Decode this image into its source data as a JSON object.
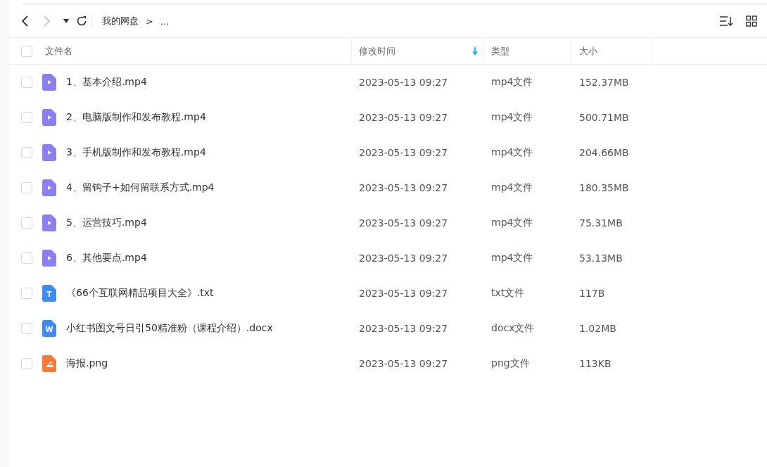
{
  "toolbar": {
    "breadcrumb": [
      {
        "label": "我的网盘"
      },
      {
        "label": "..."
      }
    ],
    "separator": ">"
  },
  "table": {
    "columns": [
      {
        "label": "文件名",
        "sorted": false
      },
      {
        "label": "修改时间",
        "sorted": true
      },
      {
        "label": "类型",
        "sorted": false
      },
      {
        "label": "大小",
        "sorted": false
      }
    ],
    "rows": [
      {
        "name": "1、基本介绍.mp4",
        "kind": "video",
        "time": "2023-05-13 09:27",
        "type": "mp4文件",
        "size": "152.37MB",
        "checked": false
      },
      {
        "name": "2、电脑版制作和发布教程.mp4",
        "kind": "video",
        "time": "2023-05-13 09:27",
        "type": "mp4文件",
        "size": "500.71MB",
        "checked": false
      },
      {
        "name": "3、手机版制作和发布教程.mp4",
        "kind": "video",
        "time": "2023-05-13 09:27",
        "type": "mp4文件",
        "size": "204.66MB",
        "checked": false
      },
      {
        "name": "4、留钩子+如何留联系方式.mp4",
        "kind": "video",
        "time": "2023-05-13 09:27",
        "type": "mp4文件",
        "size": "180.35MB",
        "checked": false
      },
      {
        "name": "5、运营技巧.mp4",
        "kind": "video",
        "time": "2023-05-13 09:27",
        "type": "mp4文件",
        "size": "75.31MB",
        "checked": false
      },
      {
        "name": "6、其他要点.mp4",
        "kind": "video",
        "time": "2023-05-13 09:27",
        "type": "mp4文件",
        "size": "53.13MB",
        "checked": false
      },
      {
        "name": "《66个互联网精品项目大全》.txt",
        "kind": "text",
        "glyph": "T",
        "time": "2023-05-13 09:27",
        "type": "txt文件",
        "size": "117B",
        "checked": false
      },
      {
        "name": "小红书图文号日引50精准粉（课程介绍）.docx",
        "kind": "doc",
        "glyph": "W",
        "time": "2023-05-13 09:27",
        "type": "docx文件",
        "size": "1.02MB",
        "checked": false
      },
      {
        "name": "海报.png",
        "kind": "image",
        "time": "2023-05-13 09:27",
        "type": "png文件",
        "size": "113KB",
        "checked": false
      }
    ],
    "all_checked": false
  }
}
